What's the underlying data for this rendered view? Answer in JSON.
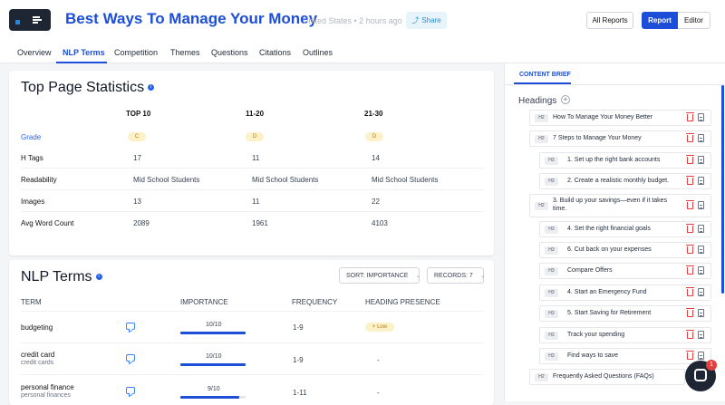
{
  "header": {
    "title": "Best Ways To Manage Your Money",
    "meta": "United States • 2 hours ago",
    "share_label": "Share",
    "all_reports_label": "All Reports",
    "report_label": "Report",
    "editor_label": "Editor"
  },
  "tabs": [
    {
      "label": "Overview"
    },
    {
      "label": "NLP Terms"
    },
    {
      "label": "Competition"
    },
    {
      "label": "Themes"
    },
    {
      "label": "Questions"
    },
    {
      "label": "Citations"
    },
    {
      "label": "Outlines"
    }
  ],
  "stats": {
    "title": "Top Page Statistics",
    "columns": [
      "TOP 10",
      "11-20",
      "21-30"
    ],
    "grade_label": "Grade",
    "grades": [
      "C",
      "D",
      "D"
    ],
    "rows": [
      {
        "label": "H Tags",
        "values": [
          "17",
          "11",
          "14"
        ]
      },
      {
        "label": "Readability",
        "values": [
          "Mid School Students",
          "Mid School Students",
          "Mid School Students"
        ]
      },
      {
        "label": "Images",
        "values": [
          "13",
          "11",
          "22"
        ]
      },
      {
        "label": "Avg Word Count",
        "values": [
          "2089",
          "1961",
          "4103"
        ]
      }
    ]
  },
  "nlp": {
    "title": "NLP Terms",
    "sort_label": "SORT: IMPORTANCE",
    "records_label": "RECORDS: 7",
    "headers": {
      "term": "TERM",
      "importance": "IMPORTANCE",
      "frequency": "FREQUENCY",
      "heading": "HEADING PRESENCE"
    },
    "rows": [
      {
        "term": "budgeting",
        "sub": "",
        "importance": "10/10",
        "importance_fraction": 1.0,
        "frequency": "1-9",
        "heading": "Low"
      },
      {
        "term": "credit card",
        "sub": "credit cards",
        "importance": "10/10",
        "importance_fraction": 1.0,
        "frequency": "1-9",
        "heading": "-"
      },
      {
        "term": "personal finance",
        "sub": "personal finances",
        "importance": "9/10",
        "importance_fraction": 0.9,
        "frequency": "1-11",
        "heading": "-"
      }
    ]
  },
  "brief": {
    "tab_label": "CONTENT BRIEF",
    "headings_label": "Headings",
    "items": [
      {
        "tag": "H2",
        "text": "How To Manage Your Money Better"
      },
      {
        "tag": "H2",
        "text": "7 Steps to Manage Your Money"
      },
      {
        "tag": "H3",
        "text": "1. Set up the right bank accounts"
      },
      {
        "tag": "H3",
        "text": "2. Create a realistic monthly budget."
      },
      {
        "tag": "H2",
        "text": "3. Build up your savings—even if it takes"
      },
      {
        "tag": "H3",
        "text": "4. Set the right financial goals"
      },
      {
        "tag": "H3",
        "text": "6. Cut back on your expenses"
      },
      {
        "tag": "H3",
        "text": "Compare Offers"
      },
      {
        "tag": "H3",
        "text": "4. Start an Emergency Fund"
      },
      {
        "tag": "H3",
        "text": "5. Start Saving for Retirement"
      },
      {
        "tag": "H3",
        "text": "Track your spending"
      },
      {
        "tag": "H3",
        "text": "Find ways to save"
      },
      {
        "tag": "H2",
        "text": "Frequently Asked Questions (FAQs)"
      }
    ],
    "item3_line2": "time."
  },
  "chat": {
    "badge": "1"
  },
  "colors": {
    "accent": "#1d4ed8",
    "danger": "#e53e3e",
    "grade_bg": "#fdf1c7"
  }
}
